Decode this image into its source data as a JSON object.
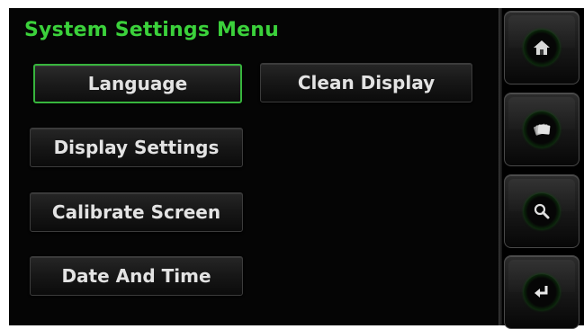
{
  "header": {
    "title": "System Settings Menu"
  },
  "menu": {
    "language": "Language",
    "clean_display": "Clean Display",
    "display_settings": "Display Settings",
    "calibrate_screen": "Calibrate Screen",
    "date_and_time": "Date And Time"
  },
  "nav": {
    "home_icon": "home-icon",
    "cards_icon": "cards-icon",
    "search_icon": "search-icon",
    "enter_icon": "enter-icon"
  },
  "colors": {
    "accent": "#3bd13b",
    "active_border": "#37b53d",
    "background": "#050505",
    "label": "#e3e3e3"
  }
}
